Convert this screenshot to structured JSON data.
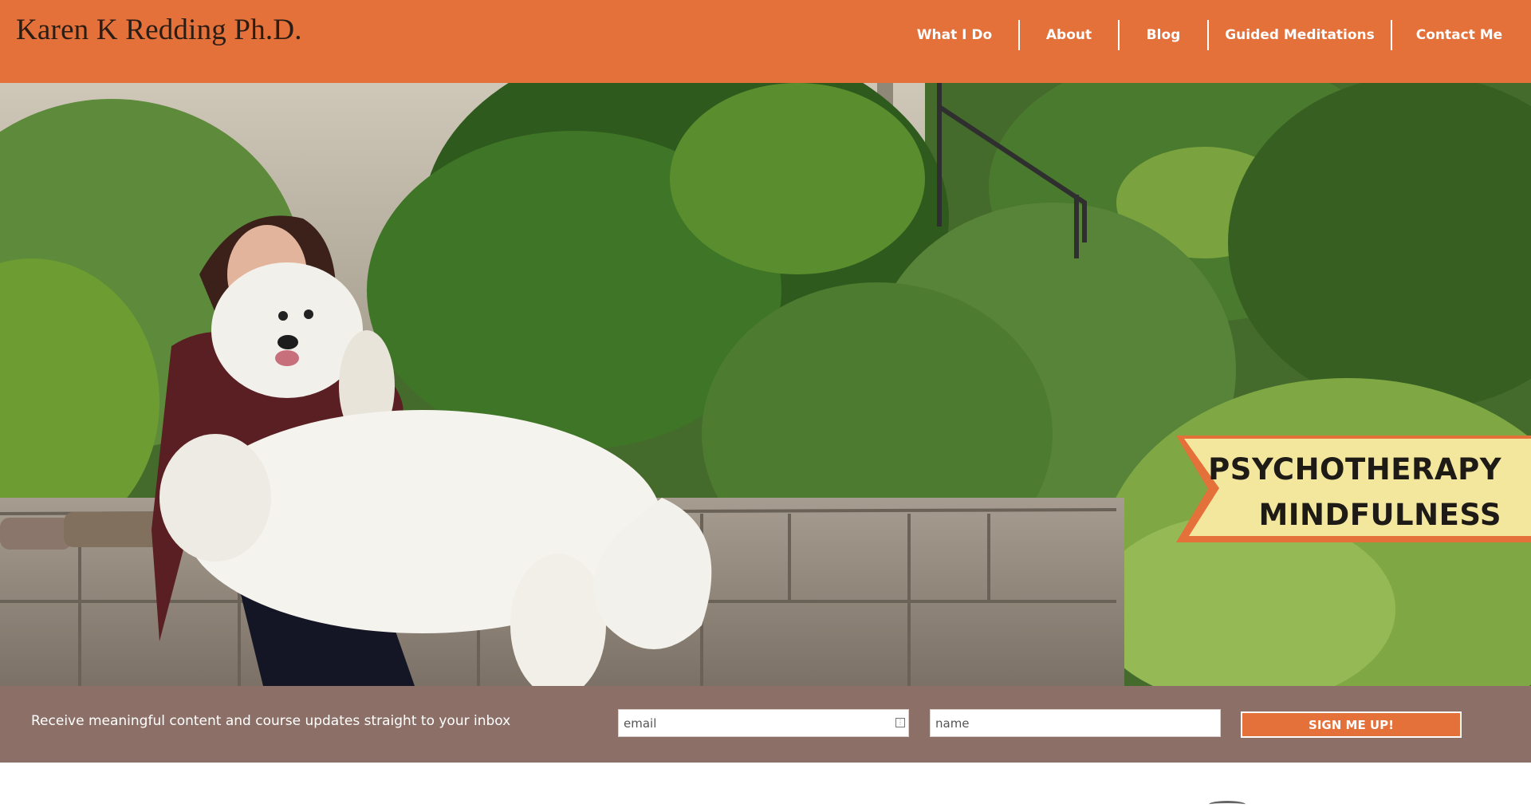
{
  "header": {
    "site_title": "Karen K Redding Ph.D.",
    "nav": [
      "What I Do",
      "About",
      "Blog",
      "Guided Meditations",
      "Contact Me"
    ],
    "bg_color": "#e4703a"
  },
  "hero": {
    "banner_line1": "PSYCHOTHERAPY",
    "banner_line2": "MINDFULNESS",
    "banner_color": "#f3e79e",
    "accent_color": "#e4703a"
  },
  "signup": {
    "text": "Receive meaningful content and course updates straight to your inbox",
    "email_placeholder": "email",
    "name_placeholder": "name",
    "button_label": "SIGN ME UP!",
    "bg_color": "#8c7067"
  }
}
